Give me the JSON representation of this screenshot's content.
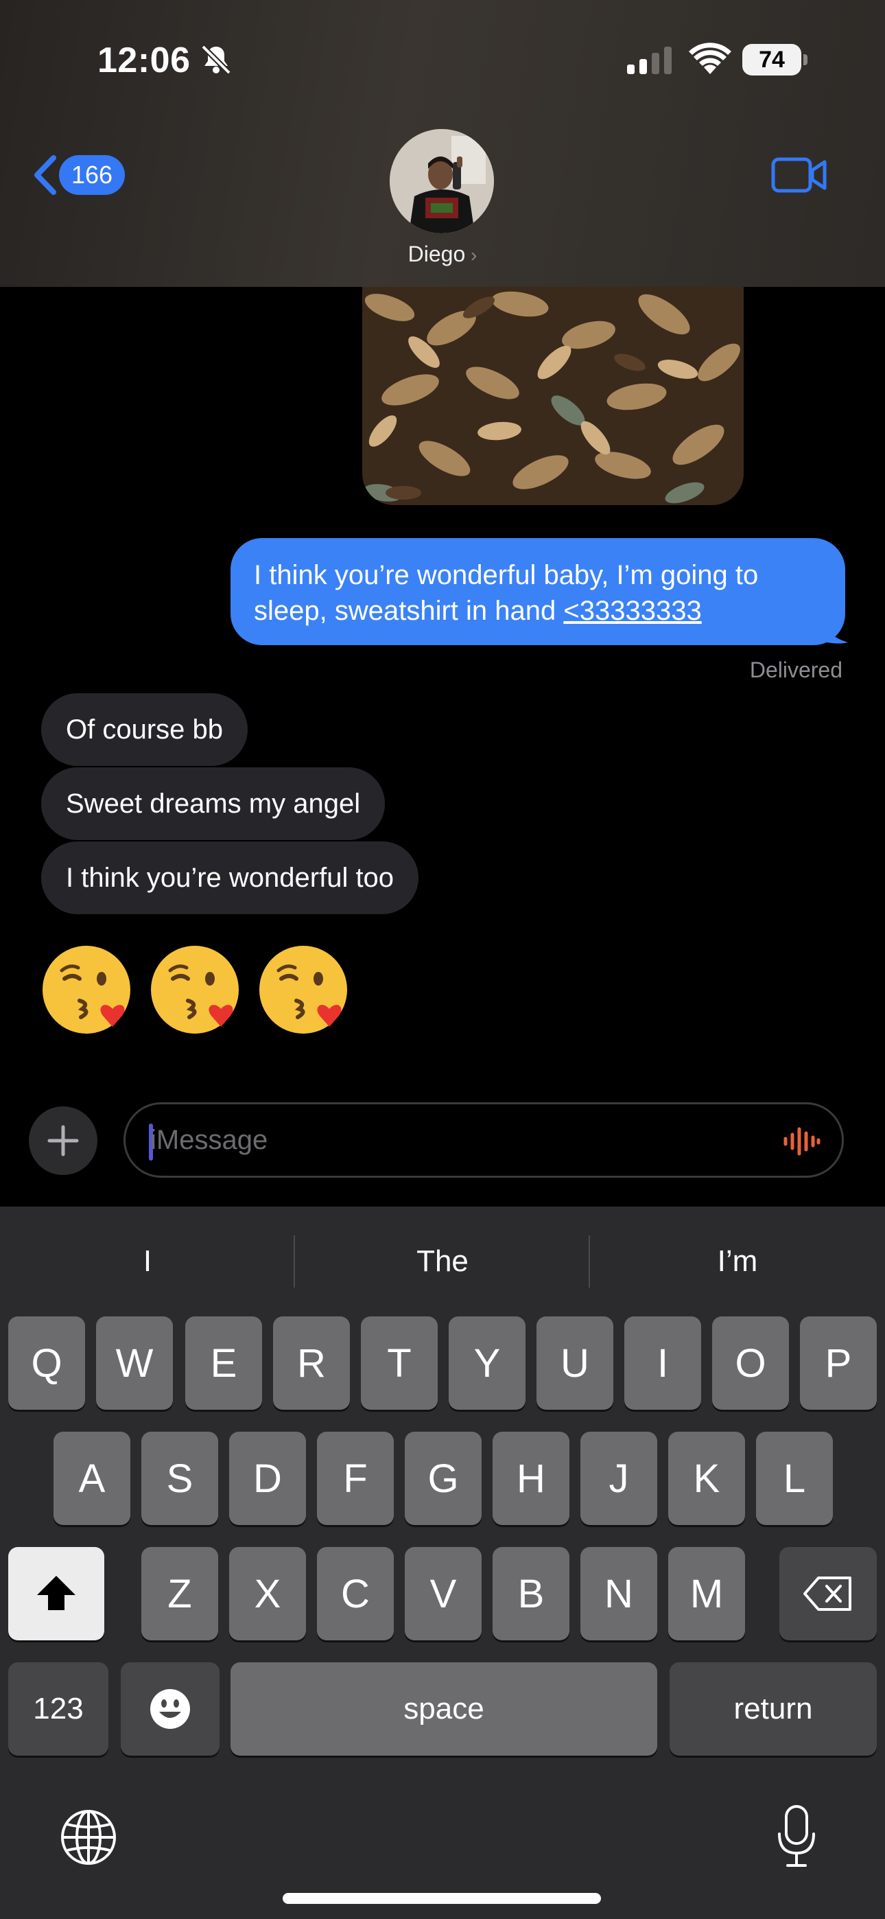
{
  "status_bar": {
    "time": "12:06",
    "battery": "74"
  },
  "header": {
    "back_count": "166",
    "contact_name": "Diego"
  },
  "messages": {
    "sent": {
      "text": "I think you’re wonderful baby, I’m going to",
      "text_line2": "sleep, sweatshirt in hand ",
      "link": "<33333333",
      "status": "Delivered"
    },
    "received": [
      "Of course bb",
      "Sweet dreams my angel",
      "I think you’re wonderful too"
    ],
    "emojis": [
      "kissing-heart",
      "kissing-heart",
      "kissing-heart"
    ]
  },
  "composer": {
    "placeholder": "iMessage"
  },
  "keyboard": {
    "suggestions": [
      "I",
      "The",
      "I’m"
    ],
    "row1": [
      "Q",
      "W",
      "E",
      "R",
      "T",
      "Y",
      "U",
      "I",
      "O",
      "P"
    ],
    "row2": [
      "A",
      "S",
      "D",
      "F",
      "G",
      "H",
      "J",
      "K",
      "L"
    ],
    "row3": [
      "Z",
      "X",
      "C",
      "V",
      "B",
      "N",
      "M"
    ],
    "numbers_label": "123",
    "space_label": "space",
    "return_label": "return"
  },
  "colors": {
    "accent": "#3478f6",
    "sent_bubble": "#3b82f6",
    "received_bubble": "#26262a"
  }
}
